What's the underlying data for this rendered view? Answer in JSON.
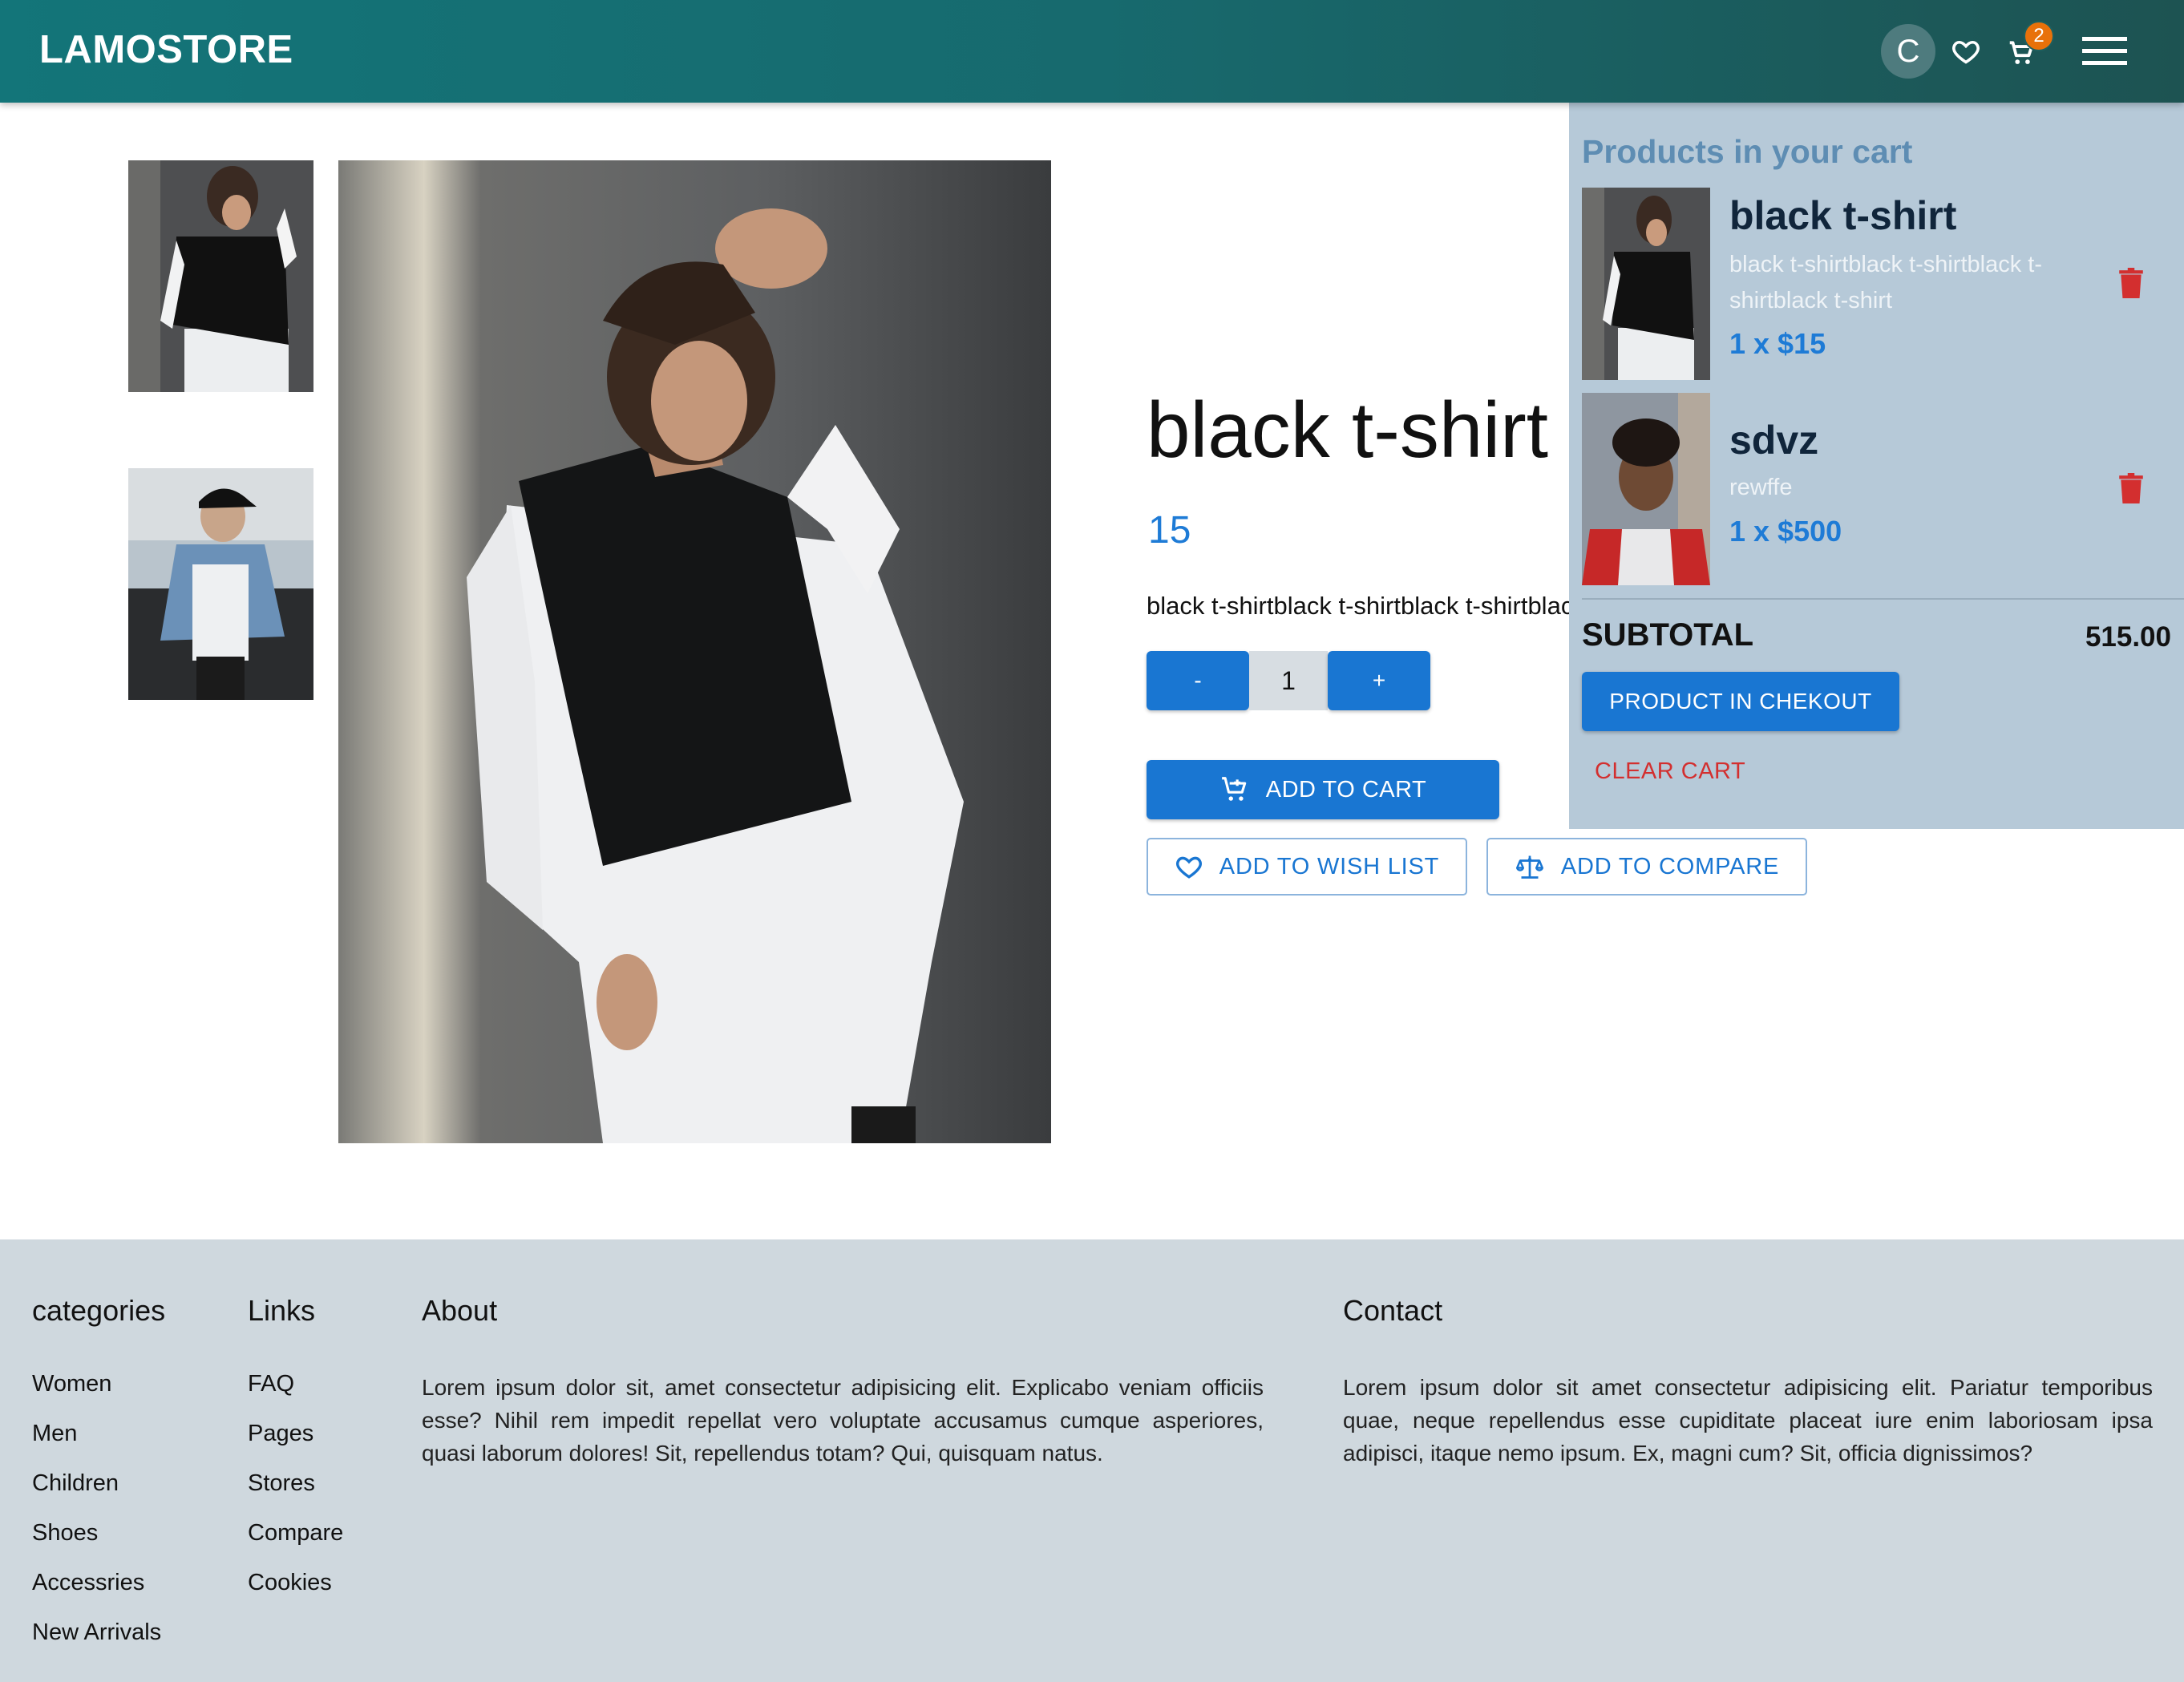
{
  "header": {
    "logo": "LAMOSTORE",
    "avatar_letter": "C",
    "cart_count": "2"
  },
  "product": {
    "title": "black t-shirt",
    "price": "15",
    "description": "black t-shirtblack t-shirtblack t-shirtblack t-shirt",
    "quantity": "1",
    "minus_label": "-",
    "plus_label": "+",
    "add_to_cart": "ADD TO CART",
    "add_to_wishlist": "ADD TO WISH LIST",
    "add_to_compare": "ADD TO COMPARE"
  },
  "cart": {
    "title": "Products in your cart",
    "items": [
      {
        "name": "black t-shirt",
        "description": "black t-shirtblack t-shirtblack t-shirtblack t-shirt",
        "qty_price": "1 x $15"
      },
      {
        "name": "sdvz",
        "description": "rewffe",
        "qty_price": "1 x $500"
      }
    ],
    "subtotal_label": "SUBTOTAL",
    "subtotal_value": "515.00",
    "checkout_label": "PRODUCT IN CHEKOUT",
    "clear_label": "CLEAR CART"
  },
  "footer": {
    "categories": {
      "title": "categories",
      "items": [
        "Women",
        "Men",
        "Children",
        "Shoes",
        "Accessries",
        "New Arrivals"
      ]
    },
    "links": {
      "title": "Links",
      "items": [
        "FAQ",
        "Pages",
        "Stores",
        "Compare",
        "Cookies"
      ]
    },
    "about": {
      "title": "About",
      "text": "Lorem ipsum dolor sit, amet consectetur adipisicing elit. Explicabo veniam officiis esse? Nihil rem impedit repellat vero voluptate accusamus cumque asperiores, quasi laborum dolores! Sit, repellendus totam? Qui, quisquam natus."
    },
    "contact": {
      "title": "Contact",
      "text": "Lorem ipsum dolor sit amet consectetur adipisicing elit. Pariatur temporibus quae, neque repellendus esse cupiditate placeat iure enim laboriosam ipsa adipisci, itaque nemo ipsum. Ex, magni cum? Sit, officia dignissimos?"
    }
  },
  "colors": {
    "header_gradient_start": "#137579",
    "header_gradient_end": "#1d5352",
    "primary_blue": "#1976d2",
    "badge_orange": "#e8710a",
    "delete_red": "#d32f2f",
    "cart_panel_bg": "#b6c9d8",
    "footer_bg": "#cfd8de"
  },
  "icons": {
    "wishlist": "heart-outline-icon",
    "cart": "shopping-cart-icon",
    "menu": "hamburger-menu-icon",
    "add_cart": "add-shopping-cart-icon",
    "compare": "balance-scale-icon",
    "delete": "trash-icon"
  }
}
